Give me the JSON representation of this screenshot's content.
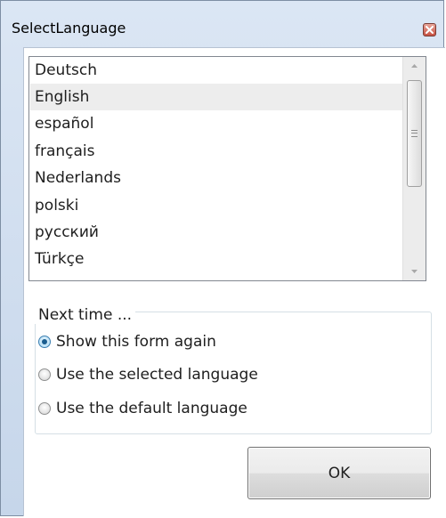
{
  "window": {
    "title": "SelectLanguage",
    "close_icon": "close-x-icon"
  },
  "languages": {
    "selected_index": 1,
    "items": [
      "Deutsch",
      "English",
      "español",
      "français",
      "Nederlands",
      "polski",
      "русский",
      "Türkçe"
    ]
  },
  "next_time": {
    "legend": "Next time ...",
    "options": [
      {
        "label": "Show this form again",
        "checked": true
      },
      {
        "label": "Use the selected language",
        "checked": false
      },
      {
        "label": "Use the default language",
        "checked": false
      }
    ]
  },
  "buttons": {
    "ok_label": "OK"
  },
  "colors": {
    "title_bar": "#dbe6f4",
    "close_button": "#c75042",
    "selected_item": "#ededed",
    "radio_checked": "#1a5d8f"
  }
}
